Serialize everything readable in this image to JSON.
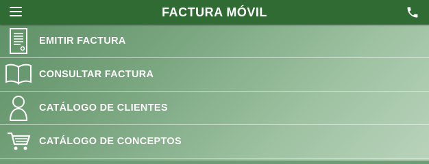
{
  "header": {
    "title": "FACTURA MÓVIL",
    "menu_icon": "hamburger-menu-icon",
    "phone_icon": "phone-icon"
  },
  "menu": {
    "items": [
      {
        "label": "EMITIR FACTURA",
        "icon": "invoice-document-icon"
      },
      {
        "label": "CONSULTAR FACTURA",
        "icon": "open-book-icon"
      },
      {
        "label": "CATÁLOGO DE CLIENTES",
        "icon": "person-icon"
      },
      {
        "label": "CATÁLOGO DE CONCEPTOS",
        "icon": "shopping-cart-icon"
      }
    ]
  },
  "colors": {
    "header": "#2f6b33",
    "text": "#ffffff"
  }
}
